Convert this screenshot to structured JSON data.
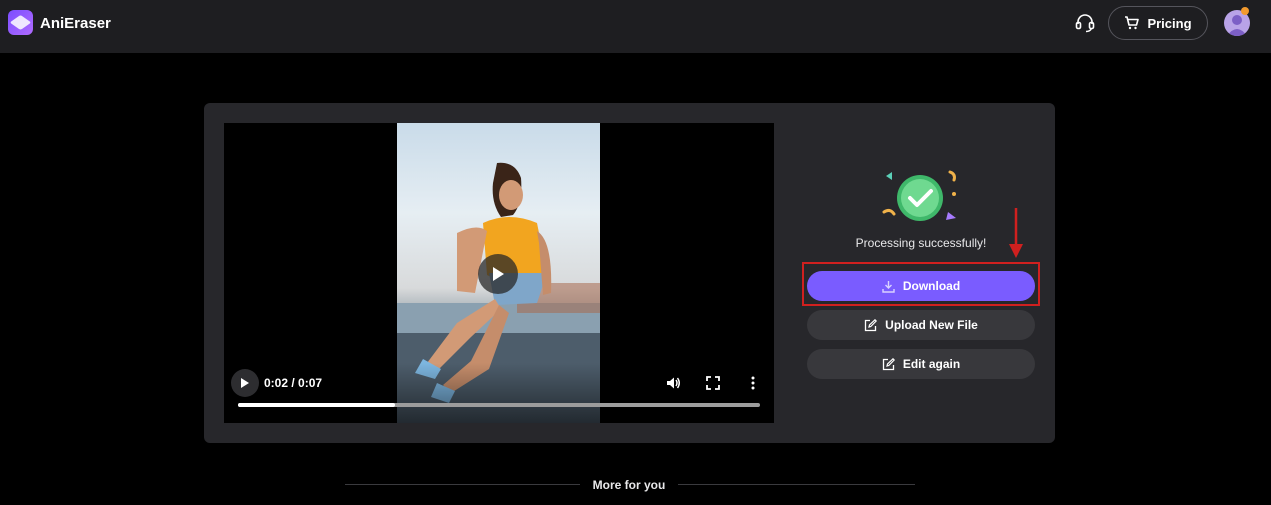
{
  "header": {
    "app_name": "AniEraser",
    "pricing_label": "Pricing",
    "icons": [
      "logo-icon",
      "headset-icon",
      "cart-icon",
      "avatar"
    ]
  },
  "player": {
    "time": "0:02 / 0:07",
    "progress": 0.3,
    "controls": [
      "play-icon",
      "volume-icon",
      "fullscreen-icon",
      "more-options-icon"
    ]
  },
  "result": {
    "status": "Processing successfully!",
    "download_label": "Download",
    "upload_label": "Upload New File",
    "edit_label": "Edit again"
  },
  "footer": {
    "more_title": "More for you"
  },
  "colors": {
    "accent": "#7a5cff",
    "highlight": "#d0201f",
    "card": "#27272b",
    "topbar": "#1e1e21"
  }
}
